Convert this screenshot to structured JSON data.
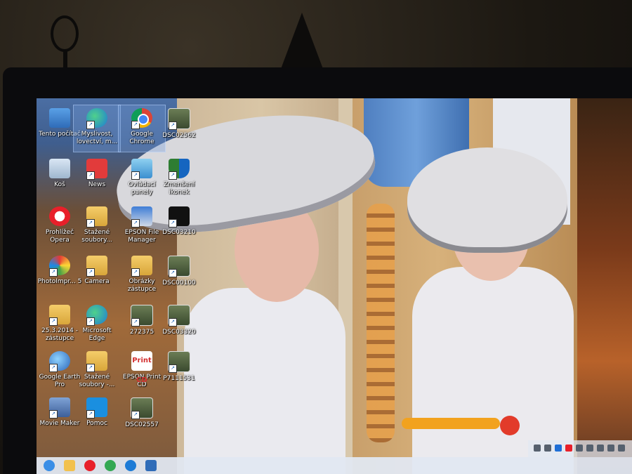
{
  "desktop": {
    "icons": [
      {
        "label": "Tento počítač",
        "icon": "computer-icon",
        "selected": false
      },
      {
        "label": "Myslivost, lovectví, m...",
        "icon": "edge-shortcut-icon",
        "selected": true
      },
      {
        "label": "Google Chrome",
        "icon": "chrome-icon",
        "selected": true
      },
      {
        "label": "DSC02562",
        "icon": "image-file-icon",
        "selected": false
      },
      {
        "label": "Koš",
        "icon": "recycle-bin-icon",
        "selected": false
      },
      {
        "label": "News",
        "icon": "news-icon",
        "selected": false
      },
      {
        "label": "Ovládací panely",
        "icon": "control-panel-icon",
        "selected": false
      },
      {
        "label": "Zmenšení ikonek",
        "icon": "shield-icon",
        "selected": false
      },
      {
        "label": "Prohlížeč Opera",
        "icon": "opera-icon",
        "selected": false
      },
      {
        "label": "Stažené soubory...",
        "icon": "downloads-folder-icon",
        "selected": false
      },
      {
        "label": "EPSON File Manager",
        "icon": "epson-icon",
        "selected": false
      },
      {
        "label": "DSC03210",
        "icon": "moon-image-icon",
        "selected": false
      },
      {
        "label": "PhotoImpr... 5",
        "icon": "photoimpression-icon",
        "selected": false
      },
      {
        "label": "Camera",
        "icon": "camera-folder-icon",
        "selected": false
      },
      {
        "label": "Obrázky zástupce",
        "icon": "pictures-folder-icon",
        "selected": false
      },
      {
        "label": "DSC00100",
        "icon": "image-file-icon",
        "selected": false
      },
      {
        "label": "25.3.2014 - zástupce",
        "icon": "folder-shortcut-icon",
        "selected": false
      },
      {
        "label": "Microsoft Edge",
        "icon": "edge-icon",
        "selected": false
      },
      {
        "label": "272375",
        "icon": "image-file-icon",
        "selected": false
      },
      {
        "label": "DSC03320",
        "icon": "image-file-icon",
        "selected": false
      },
      {
        "label": "Google Earth Pro",
        "icon": "google-earth-icon",
        "selected": false
      },
      {
        "label": "Stažené soubory -...",
        "icon": "downloads-folder-icon",
        "selected": false
      },
      {
        "label": "EPSON Print CD",
        "icon": "epson-print-icon",
        "selected": false
      },
      {
        "label": "P7111531",
        "icon": "image-file-icon",
        "selected": false
      },
      {
        "label": "Movie Maker",
        "icon": "movie-maker-icon",
        "selected": false
      },
      {
        "label": "Pomoc",
        "icon": "teamviewer-icon",
        "selected": false
      },
      {
        "label": "DSC02557",
        "icon": "image-file-icon",
        "selected": false
      }
    ],
    "print_glyph_text": "Print CD"
  },
  "taskbar": {
    "apps": [
      "start-icon",
      "file-explorer-icon",
      "opera-icon",
      "chrome-icon",
      "edge-icon",
      "photos-icon"
    ],
    "tray": [
      "volume-icon",
      "network-icon",
      "bluetooth-icon",
      "opera-tray-icon",
      "display-icon",
      "keyboard-icon",
      "battery-icon",
      "speaker-icon",
      "notification-icon"
    ]
  },
  "colors": {
    "taskbar": "#e1e8f2",
    "selection": "#78a0dc",
    "bezel": "#0b0b0d"
  }
}
